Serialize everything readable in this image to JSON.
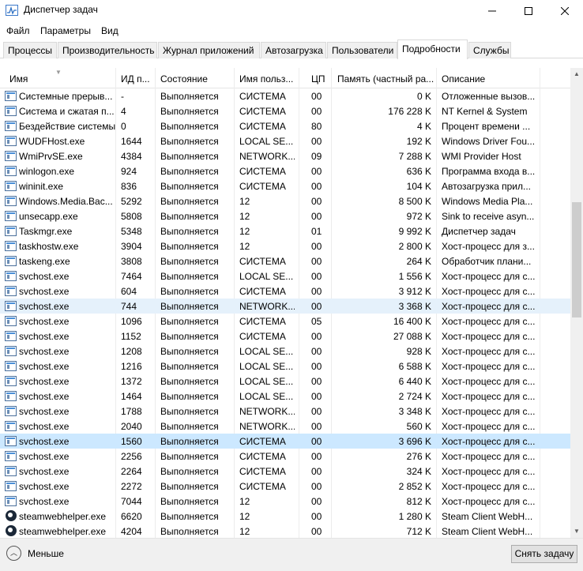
{
  "window": {
    "title": "Диспетчер задач"
  },
  "menu": [
    "Файл",
    "Параметры",
    "Вид"
  ],
  "tabs": [
    "Процессы",
    "Производительность",
    "Журнал приложений",
    "Автозагрузка",
    "Пользователи",
    "Подробности",
    "Службы"
  ],
  "active_tab": "Подробности",
  "columns": {
    "name": "Имя",
    "pid": "ИД п...",
    "state": "Состояние",
    "user": "Имя польз...",
    "cpu": "ЦП",
    "memory": "Память (частный ра...",
    "description": "Описание"
  },
  "rows": [
    {
      "name": "Системные прерыв...",
      "pid": "-",
      "state": "Выполняется",
      "user": "СИСТЕМА",
      "cpu": "00",
      "memory": "0 K",
      "description": "Отложенные вызов...",
      "icon": "process-icon"
    },
    {
      "name": "Система и сжатая п...",
      "pid": "4",
      "state": "Выполняется",
      "user": "СИСТЕМА",
      "cpu": "00",
      "memory": "176 228 K",
      "description": "NT Kernel & System",
      "icon": "process-icon"
    },
    {
      "name": "Бездействие системы",
      "pid": "0",
      "state": "Выполняется",
      "user": "СИСТЕМА",
      "cpu": "80",
      "memory": "4 K",
      "description": "Процент времени ...",
      "icon": "process-icon"
    },
    {
      "name": "WUDFHost.exe",
      "pid": "1644",
      "state": "Выполняется",
      "user": "LOCAL SE...",
      "cpu": "00",
      "memory": "192 K",
      "description": "Windows Driver Fou...",
      "icon": "process-icon"
    },
    {
      "name": "WmiPrvSE.exe",
      "pid": "4384",
      "state": "Выполняется",
      "user": "NETWORK...",
      "cpu": "09",
      "memory": "7 288 K",
      "description": "WMI Provider Host",
      "icon": "process-icon"
    },
    {
      "name": "winlogon.exe",
      "pid": "924",
      "state": "Выполняется",
      "user": "СИСТЕМА",
      "cpu": "00",
      "memory": "636 K",
      "description": "Программа входа в...",
      "icon": "process-icon"
    },
    {
      "name": "wininit.exe",
      "pid": "836",
      "state": "Выполняется",
      "user": "СИСТЕМА",
      "cpu": "00",
      "memory": "104 K",
      "description": "Автозагрузка прил...",
      "icon": "process-icon"
    },
    {
      "name": "Windows.Media.Bac...",
      "pid": "5292",
      "state": "Выполняется",
      "user": "12",
      "cpu": "00",
      "memory": "8 500 K",
      "description": "Windows Media Pla...",
      "icon": "process-icon"
    },
    {
      "name": "unsecapp.exe",
      "pid": "5808",
      "state": "Выполняется",
      "user": "12",
      "cpu": "00",
      "memory": "972 K",
      "description": "Sink to receive asyn...",
      "icon": "process-icon"
    },
    {
      "name": "Taskmgr.exe",
      "pid": "5348",
      "state": "Выполняется",
      "user": "12",
      "cpu": "01",
      "memory": "9 992 K",
      "description": "Диспетчер задач",
      "icon": "process-icon"
    },
    {
      "name": "taskhostw.exe",
      "pid": "3904",
      "state": "Выполняется",
      "user": "12",
      "cpu": "00",
      "memory": "2 800 K",
      "description": "Хост-процесс для з...",
      "icon": "process-icon"
    },
    {
      "name": "taskeng.exe",
      "pid": "3808",
      "state": "Выполняется",
      "user": "СИСТЕМА",
      "cpu": "00",
      "memory": "264 K",
      "description": "Обработчик плани...",
      "icon": "process-icon"
    },
    {
      "name": "svchost.exe",
      "pid": "7464",
      "state": "Выполняется",
      "user": "LOCAL SE...",
      "cpu": "00",
      "memory": "1 556 K",
      "description": "Хост-процесс для с...",
      "icon": "process-icon"
    },
    {
      "name": "svchost.exe",
      "pid": "604",
      "state": "Выполняется",
      "user": "СИСТЕМА",
      "cpu": "00",
      "memory": "3 912 K",
      "description": "Хост-процесс для с...",
      "icon": "process-icon"
    },
    {
      "name": "svchost.exe",
      "pid": "744",
      "state": "Выполняется",
      "user": "NETWORK...",
      "cpu": "00",
      "memory": "3 368 K",
      "description": "Хост-процесс для с...",
      "icon": "process-icon",
      "highlight": "hover"
    },
    {
      "name": "svchost.exe",
      "pid": "1096",
      "state": "Выполняется",
      "user": "СИСТЕМА",
      "cpu": "05",
      "memory": "16 400 K",
      "description": "Хост-процесс для с...",
      "icon": "process-icon"
    },
    {
      "name": "svchost.exe",
      "pid": "1152",
      "state": "Выполняется",
      "user": "СИСТЕМА",
      "cpu": "00",
      "memory": "27 088 K",
      "description": "Хост-процесс для с...",
      "icon": "process-icon"
    },
    {
      "name": "svchost.exe",
      "pid": "1208",
      "state": "Выполняется",
      "user": "LOCAL SE...",
      "cpu": "00",
      "memory": "928 K",
      "description": "Хост-процесс для с...",
      "icon": "process-icon"
    },
    {
      "name": "svchost.exe",
      "pid": "1216",
      "state": "Выполняется",
      "user": "LOCAL SE...",
      "cpu": "00",
      "memory": "6 588 K",
      "description": "Хост-процесс для с...",
      "icon": "process-icon"
    },
    {
      "name": "svchost.exe",
      "pid": "1372",
      "state": "Выполняется",
      "user": "LOCAL SE...",
      "cpu": "00",
      "memory": "6 440 K",
      "description": "Хост-процесс для с...",
      "icon": "process-icon"
    },
    {
      "name": "svchost.exe",
      "pid": "1464",
      "state": "Выполняется",
      "user": "LOCAL SE...",
      "cpu": "00",
      "memory": "2 724 K",
      "description": "Хост-процесс для с...",
      "icon": "process-icon"
    },
    {
      "name": "svchost.exe",
      "pid": "1788",
      "state": "Выполняется",
      "user": "NETWORK...",
      "cpu": "00",
      "memory": "3 348 K",
      "description": "Хост-процесс для с...",
      "icon": "process-icon"
    },
    {
      "name": "svchost.exe",
      "pid": "2040",
      "state": "Выполняется",
      "user": "NETWORK...",
      "cpu": "00",
      "memory": "560 K",
      "description": "Хост-процесс для с...",
      "icon": "process-icon"
    },
    {
      "name": "svchost.exe",
      "pid": "1560",
      "state": "Выполняется",
      "user": "СИСТЕМА",
      "cpu": "00",
      "memory": "3 696 K",
      "description": "Хост-процесс для с...",
      "icon": "process-icon",
      "highlight": "selected"
    },
    {
      "name": "svchost.exe",
      "pid": "2256",
      "state": "Выполняется",
      "user": "СИСТЕМА",
      "cpu": "00",
      "memory": "276 K",
      "description": "Хост-процесс для с...",
      "icon": "process-icon"
    },
    {
      "name": "svchost.exe",
      "pid": "2264",
      "state": "Выполняется",
      "user": "СИСТЕМА",
      "cpu": "00",
      "memory": "324 K",
      "description": "Хост-процесс для с...",
      "icon": "process-icon"
    },
    {
      "name": "svchost.exe",
      "pid": "2272",
      "state": "Выполняется",
      "user": "СИСТЕМА",
      "cpu": "00",
      "memory": "2 852 K",
      "description": "Хост-процесс для с...",
      "icon": "process-icon"
    },
    {
      "name": "svchost.exe",
      "pid": "7044",
      "state": "Выполняется",
      "user": "12",
      "cpu": "00",
      "memory": "812 K",
      "description": "Хост-процесс для с...",
      "icon": "process-icon"
    },
    {
      "name": "steamwebhelper.exe",
      "pid": "6620",
      "state": "Выполняется",
      "user": "12",
      "cpu": "00",
      "memory": "1 280 K",
      "description": "Steam Client WebH...",
      "icon": "steam-icon"
    },
    {
      "name": "steamwebhelper.exe",
      "pid": "4204",
      "state": "Выполняется",
      "user": "12",
      "cpu": "00",
      "memory": "712 K",
      "description": "Steam Client WebH...",
      "icon": "steam-icon"
    }
  ],
  "footer": {
    "less_label": "Меньше",
    "end_task_label": "Снять задачу"
  }
}
